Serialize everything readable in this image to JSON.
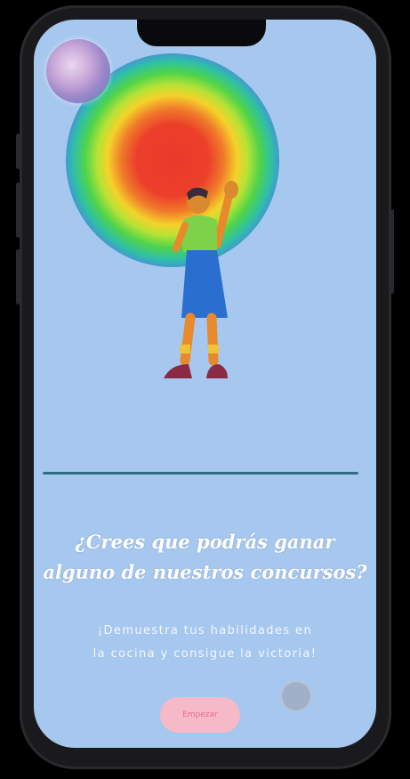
{
  "onboarding": {
    "headline_line1": "¿Crees que podrás ganar",
    "headline_line2": "alguno de nuestros concursos?",
    "subtext_line1": "¡Demuestra tus habilidades en",
    "subtext_line2": "la cocina y consigue la victoria!",
    "start_button_label": "Empezar"
  },
  "icons": {
    "avatar": "user-avatar",
    "next": "next-circle-icon"
  },
  "colors": {
    "screen_background": "#a6c7ee",
    "divider": "#2f6f86",
    "button_background": "#f5b9c8"
  }
}
